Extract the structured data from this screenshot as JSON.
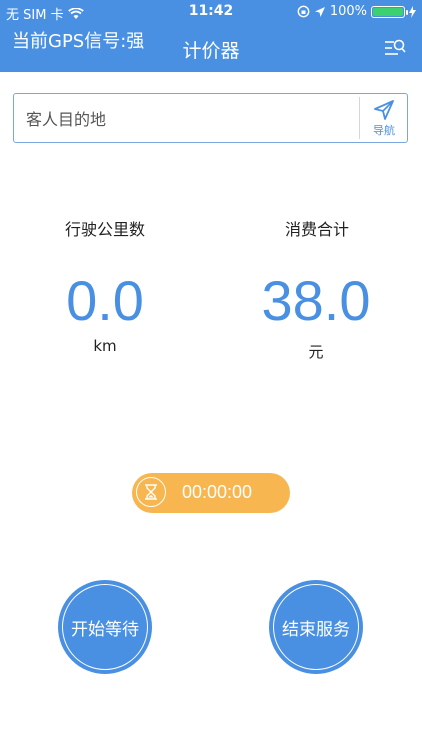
{
  "status_bar": {
    "carrier": "无 SIM 卡",
    "time": "11:42",
    "battery": "100%",
    "battery_level": 1.0
  },
  "header": {
    "gps_status": "当前GPS信号:强",
    "title": "计价器",
    "menu_icon": "search-list-icon"
  },
  "destination": {
    "placeholder": "客人目的地",
    "nav_label": "导航",
    "nav_icon": "send-arrow-icon"
  },
  "stats": {
    "distance_label": "行驶公里数",
    "distance_value": "0.0",
    "distance_unit": "km",
    "cost_label": "消费合计",
    "cost_value": "38.0",
    "cost_unit": "元"
  },
  "timer": {
    "value": "00:00:00",
    "icon": "hourglass-icon"
  },
  "actions": {
    "start_wait": "开始等待",
    "end_service": "结束服务"
  },
  "colors": {
    "primary": "#4a90e2",
    "timer": "#f7b64f"
  }
}
